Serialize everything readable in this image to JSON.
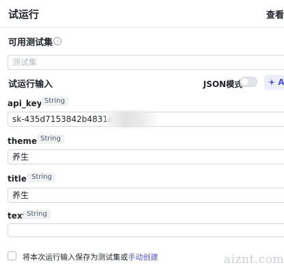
{
  "header": {
    "title": "试运行",
    "action_label": "查看"
  },
  "testset": {
    "label": "可用测试集",
    "info_icon": "info-icon",
    "placeholder": "测试集"
  },
  "run_input": {
    "label": "试运行输入",
    "json_mode_label": "JSON模式",
    "json_mode_on": false,
    "ai_button_label": "A",
    "ai_icon": "sparkle-icon"
  },
  "params": [
    {
      "name": "api_key",
      "required": "*",
      "type": "String",
      "value": "sk-435d7153842b4831afa"
    },
    {
      "name": "theme",
      "required": "*",
      "type": "String",
      "value": "养生"
    },
    {
      "name": "title",
      "required": "*",
      "type": "String",
      "value": "养生"
    },
    {
      "name": "text",
      "required": "",
      "type": "String",
      "value": ""
    }
  ],
  "save": {
    "checked": false,
    "text": "将本次运行输入保存为测试集或",
    "link": "手动创建"
  },
  "watermark": "aiznt.com",
  "colors": {
    "accent": "#4d53e8",
    "required": "#e53935",
    "border": "#d4d7dd"
  }
}
